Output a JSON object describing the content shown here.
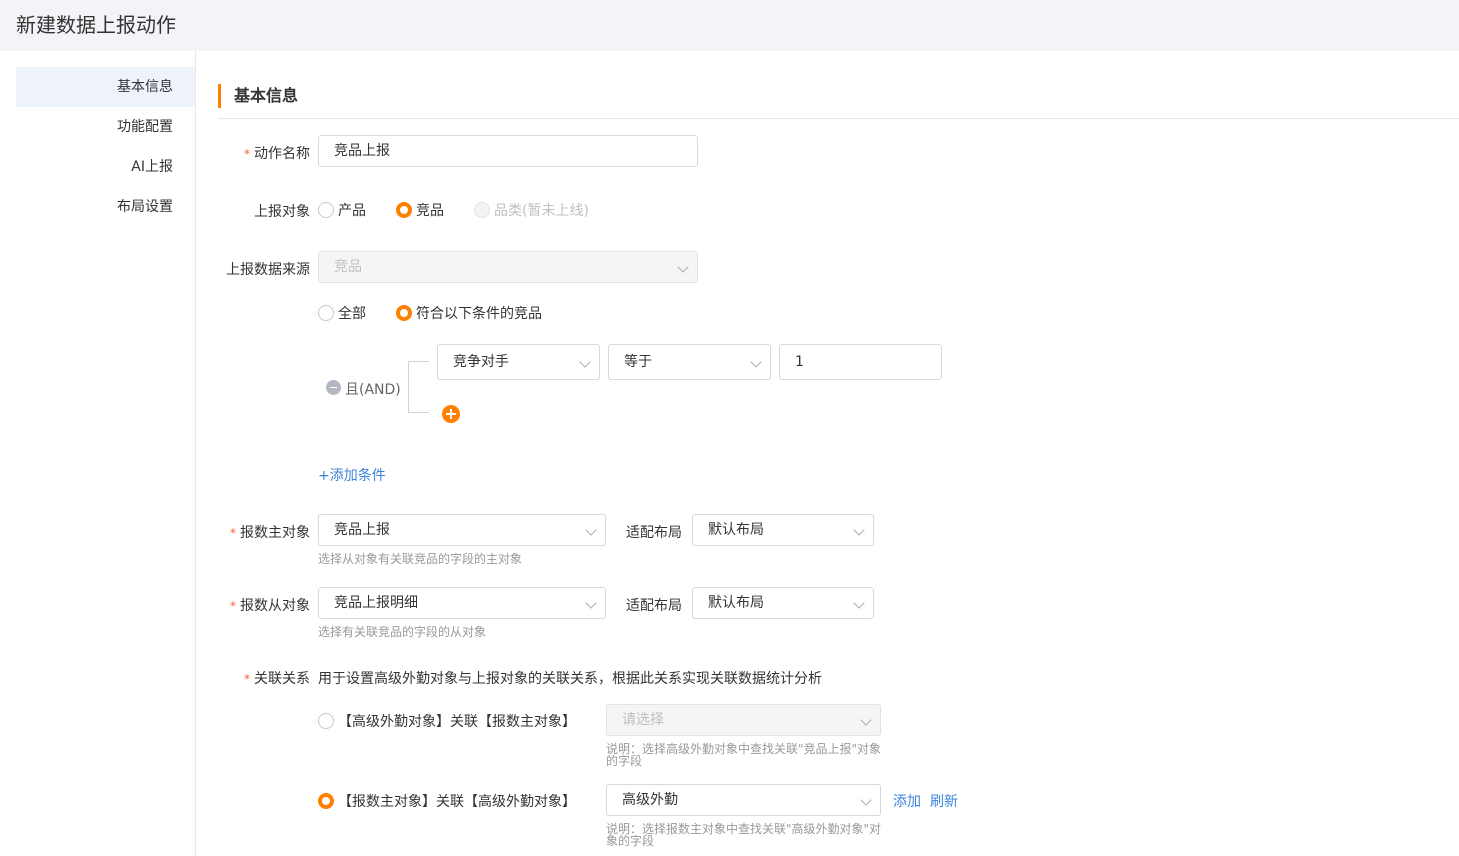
{
  "page": {
    "title": "新建数据上报动作"
  },
  "sidebar": {
    "items": [
      {
        "label": "基本信息"
      },
      {
        "label": "功能配置"
      },
      {
        "label": "AI上报"
      },
      {
        "label": "布局设置"
      }
    ]
  },
  "section": {
    "title": "基本信息"
  },
  "form": {
    "action_name": {
      "label": "动作名称",
      "value": "竞品上报"
    },
    "report_object": {
      "label": "上报对象",
      "options": [
        "产品",
        "竞品",
        "品类(暂未上线)"
      ],
      "selected": "竞品"
    },
    "data_source": {
      "label": "上报数据来源",
      "value": "竞品",
      "scope_options": [
        "全部",
        "符合以下条件的竞品"
      ],
      "scope_selected": "符合以下条件的竞品",
      "logic": "且(AND)",
      "condition": {
        "field": "竞争对手",
        "operator": "等于",
        "value": "1"
      },
      "add_condition": "+添加条件"
    },
    "main_object": {
      "label": "报数主对象",
      "value": "竞品上报",
      "hint": "选择从对象有关联竞品的字段的主对象",
      "layout_label": "适配布局",
      "layout_value": "默认布局"
    },
    "sub_object": {
      "label": "报数从对象",
      "value": "竞品上报明细",
      "hint": "选择有关联竞品的字段的从对象",
      "layout_label": "适配布局",
      "layout_value": "默认布局"
    },
    "relation": {
      "label": "关联关系",
      "desc": "用于设置高级外勤对象与上报对象的关联关系，根据此关系实现关联数据统计分析",
      "option1": {
        "label": "【高级外勤对象】关联【报数主对象】",
        "placeholder": "请选择",
        "hint_line1": "说明：选择高级外勤对象中查找关联\"竞品上报\"对象",
        "hint_line2": "的字段"
      },
      "option2": {
        "label": "【报数主对象】关联【高级外勤对象】",
        "value": "高级外勤",
        "hint_line1": "说明：选择报数主对象中查找关联\"高级外勤对象\"对",
        "hint_line2": "象的字段",
        "add": "添加",
        "refresh": "刷新"
      },
      "selected": 2
    }
  }
}
